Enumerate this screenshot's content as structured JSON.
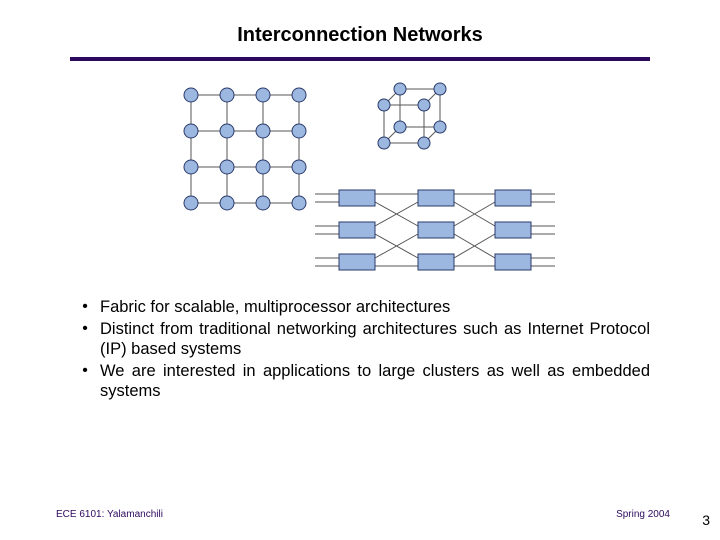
{
  "title": "Interconnection Networks",
  "bullets": [
    "Fabric for scalable, multiprocessor architectures",
    "Distinct from traditional networking architectures such as Internet Protocol (IP) based systems",
    "We are interested in applications to large clusters as well as embedded systems"
  ],
  "footer": {
    "left": "ECE 6101: Yalamanchili",
    "right": "Spring 2004"
  },
  "page_number": "3",
  "diagrams": {
    "mesh": "4x4 mesh topology",
    "hypercube": "3D cube topology",
    "multistage": "3-stage switch network"
  },
  "colors": {
    "accent": "#2e0a5e",
    "node_fill": "#9db8e0",
    "node_stroke": "#2a3a6a"
  }
}
